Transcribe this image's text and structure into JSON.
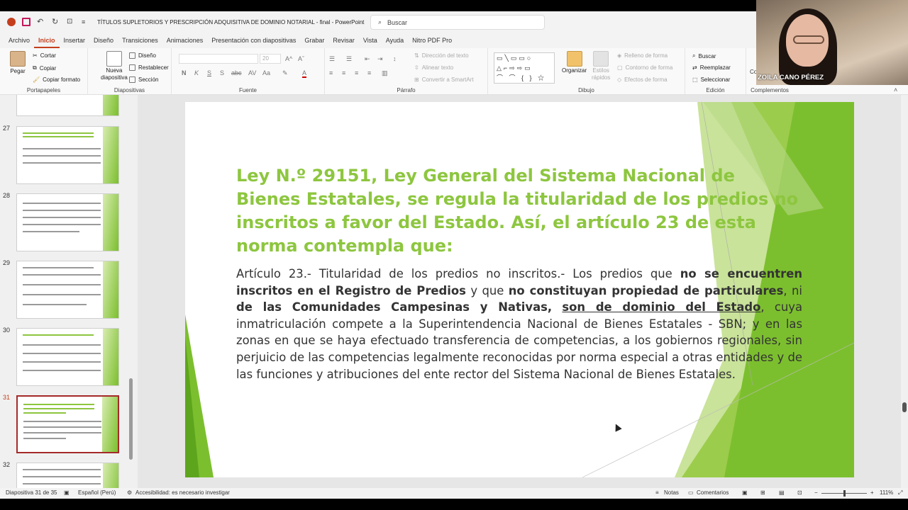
{
  "titlebar": {
    "document_title": "TÍTULOS SUPLETORIOS Y PRESCRIPCIÓN ADQUISITIVA DE DOMINIO NOTARIAL - final  -  PowerPoint",
    "search_placeholder": "Buscar"
  },
  "menu": {
    "tabs": [
      "Archivo",
      "Inicio",
      "Insertar",
      "Diseño",
      "Transiciones",
      "Animaciones",
      "Presentación con diapositivas",
      "Grabar",
      "Revisar",
      "Vista",
      "Ayuda",
      "Nitro PDF Pro"
    ],
    "active": "Inicio"
  },
  "ribbon": {
    "portapapeles": {
      "label": "Portapapeles",
      "pegar": "Pegar",
      "cortar": "Cortar",
      "copiar": "Copiar",
      "copiar_formato": "Copiar formato"
    },
    "diapositivas": {
      "label": "Diapositivas",
      "nueva": "Nueva",
      "diapositiva": "diapositiva",
      "diseno": "Diseño",
      "restablecer": "Restablecer",
      "seccion": "Sección"
    },
    "fuente": {
      "label": "Fuente",
      "size": "20"
    },
    "parrafo": {
      "label": "Párrafo",
      "direccion": "Dirección del texto",
      "alinear": "Alinear texto",
      "smartart": "Convertir a SmartArt"
    },
    "dibujo": {
      "label": "Dibujo",
      "organizar": "Organizar",
      "estilos": "Estilos",
      "rapidos": "rápidos",
      "relleno": "Relleno de forma",
      "contorno": "Contorno de forma",
      "efectos": "Efectos de forma"
    },
    "edicion": {
      "label": "Edición",
      "buscar": "Buscar",
      "reemplazar": "Reemplazar",
      "seleccionar": "Seleccionar"
    },
    "complementos": {
      "label": "Complementos"
    }
  },
  "video": {
    "participant_name": "ZOILA CANO PÉREZ",
    "partial": "Co"
  },
  "thumbnails": [
    {
      "num": "27"
    },
    {
      "num": "28"
    },
    {
      "num": "29"
    },
    {
      "num": "30"
    },
    {
      "num": "31"
    },
    {
      "num": "32"
    }
  ],
  "slide": {
    "title": "Ley N.º 29151, Ley General del Sistema Nacional de Bienes Estatales, se regula la titularidad de los predios no inscritos a favor del Estado. Así, el artículo 23 de esta norma contempla que:",
    "body": {
      "p1": "Artículo 23.- Titularidad de los predios no inscritos.- Los predios que ",
      "b1": "no se encuentren inscritos en el Registro de Predios",
      "p2": " y que ",
      "b2": "no constituyan propiedad de particulares",
      "p3": ", ni ",
      "b3": "de las Comunidades Campesinas y Nativas,",
      "p4": " ",
      "u1": "son de dominio del Estado",
      "p5": ", cuya inmatriculación compete a la Superintendencia Nacional de Bienes Estatales - SBN; y en las zonas en que se haya efectuado transferencia de competencias, a los gobiernos regionales, sin perjuicio de las competencias legalmente reconocidas por norma especial a otras entidades y de las funciones y atribuciones del ente rector del Sistema Nacional de Bienes Estatales."
    }
  },
  "status": {
    "slide_info": "Diapositiva 31 de 35",
    "language": "Español (Perú)",
    "accessibility": "Accesibilidad: es necesario investigar",
    "notas": "Notas",
    "comentarios": "Comentarios",
    "zoom": "111%"
  },
  "colors": {
    "accent": "#c43e1c",
    "slide_green": "#8dc63f",
    "selected_thumb": "#a52a2a"
  }
}
